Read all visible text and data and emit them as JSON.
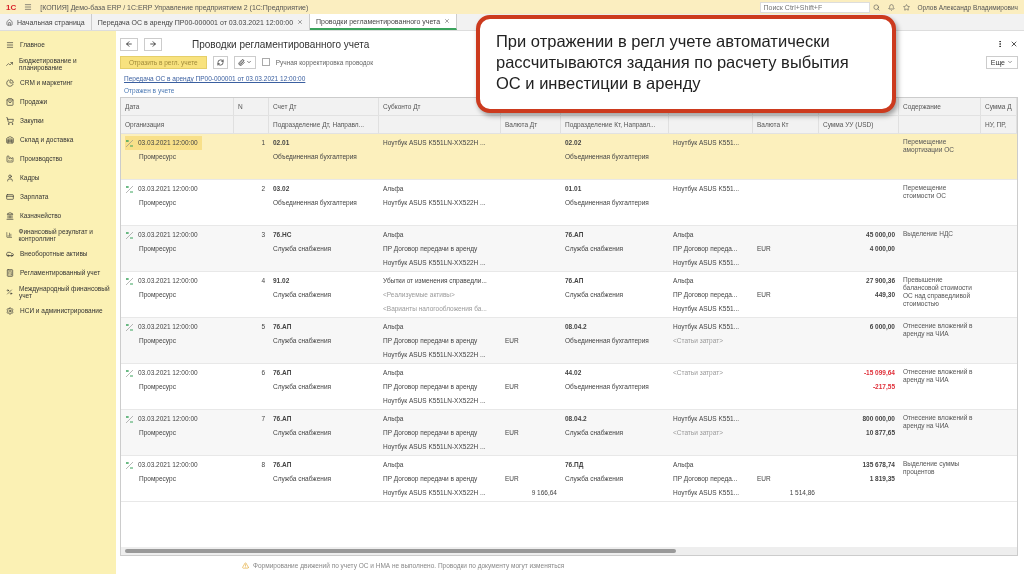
{
  "titlebar": {
    "logo": "1С",
    "title": "[КОПИЯ] Демо-база ERP / 1С:ERP Управление предприятием 2 (1С:Предприятие)",
    "search_placeholder": "Поиск Ctrl+Shift+F",
    "user": "Орлов Александр Владимирович"
  },
  "tabs": [
    {
      "label": "Начальная страница",
      "kind": "home",
      "selected": false
    },
    {
      "label": "Передача ОС в аренду ПР00-000001 от 03.03.2021 12:00:00",
      "kind": "doc",
      "selected": false
    },
    {
      "label": "Проводки регламентированного учета",
      "kind": "doc",
      "selected": true
    }
  ],
  "sidebar": {
    "items": [
      {
        "label": "Главное"
      },
      {
        "label": "Бюджетирование и планирование"
      },
      {
        "label": "CRM и маркетинг"
      },
      {
        "label": "Продажи"
      },
      {
        "label": "Закупки"
      },
      {
        "label": "Склад и доставка"
      },
      {
        "label": "Производство"
      },
      {
        "label": "Кадры"
      },
      {
        "label": "Зарплата"
      },
      {
        "label": "Казначейство"
      },
      {
        "label": "Финансовый результат и контроллинг"
      },
      {
        "label": "Внеоборотные активы"
      },
      {
        "label": "Регламентированный учет"
      },
      {
        "label": "Международный финансовый учет"
      },
      {
        "label": "НСИ и администрирование"
      }
    ]
  },
  "form": {
    "title": "Проводки регламентированного учета",
    "post_button": "Отразить в регл. учете",
    "manual_checkbox": {
      "label": "Ручная корректировка проводок",
      "checked": false
    },
    "more_button": "Еще",
    "document_link": "Передача ОС в аренду ПР00-000001 от 03.03.2021 12:00:00",
    "status_label": "Отражен в учете"
  },
  "table": {
    "columns": [
      {
        "top": "Дата",
        "bottom": "Организация"
      },
      {
        "top": "N"
      },
      {
        "top": "Счет Дт",
        "bottom": "Подразделение Дт, Направл..."
      },
      {
        "top": "Субконто Дт"
      },
      {
        "bottom": "Валюта Дт"
      },
      {
        "bottom": "Подразделение Кт, Направл..."
      },
      {},
      {
        "bottom": "Валюта Кт"
      },
      {
        "bottom": "Сумма УУ (USD)"
      },
      {
        "top": "Содержание"
      },
      {
        "top": "Сумма Д",
        "bottom": "НУ, ПР,"
      }
    ],
    "rows": [
      {
        "selected": true,
        "date": "03.03.2021 12:00:00",
        "org": "Промресурс",
        "n": "1",
        "dt": "02.01",
        "dt_div": "Объединенная бухгалтерия",
        "sub_dt": [
          {
            "text": "Ноутбук ASUS K551LN-XX522H ...",
            "empty": false
          }
        ],
        "cur_dt": "",
        "amt_dt": "",
        "kt": "02.02",
        "kt_div": "Объединенная бухгалтерия",
        "sub_kt": [
          {
            "text": "Ноутбук ASUS K551...",
            "empty": false
          }
        ],
        "cur_kt": "",
        "amt_kt": "",
        "sum": "",
        "sum2": "",
        "content": "Перемещение амортизации ОС"
      },
      {
        "selected": false,
        "date": "03.03.2021 12:00:00",
        "org": "Промресурс",
        "n": "2",
        "dt": "03.02",
        "dt_div": "Объединенная бухгалтерия",
        "sub_dt": [
          {
            "text": "Альфа",
            "empty": false
          },
          {
            "text": "Ноутбук ASUS K551LN-XX522H ...",
            "empty": false
          }
        ],
        "cur_dt": "",
        "amt_dt": "",
        "kt": "01.01",
        "kt_div": "Объединенная бухгалтерия",
        "sub_kt": [
          {
            "text": "Ноутбук ASUS K551...",
            "empty": false
          }
        ],
        "cur_kt": "",
        "amt_kt": "",
        "sum": "",
        "sum2": "",
        "content": "Перемещение стоимости ОС"
      },
      {
        "selected": false,
        "date": "03.03.2021 12:00:00",
        "org": "Промресурс",
        "n": "3",
        "dt": "76.НС",
        "dt_div": "Служба снабжения",
        "sub_dt": [
          {
            "text": "Альфа",
            "empty": false
          },
          {
            "text": "ПР Договор передачи в аренду",
            "empty": false
          },
          {
            "text": "Ноутбук ASUS K551LN-XX522H ...",
            "empty": false
          }
        ],
        "cur_dt": "",
        "amt_dt": "",
        "kt": "76.АП",
        "kt_div": "Служба снабжения",
        "sub_kt": [
          {
            "text": "Альфа",
            "empty": false
          },
          {
            "text": "ПР Договор переда...",
            "empty": false
          },
          {
            "text": "Ноутбук ASUS K551...",
            "empty": false
          }
        ],
        "cur_kt": "EUR",
        "amt_kt": "",
        "sum": "45 000,00",
        "sum2": "4 000,00",
        "negative": false,
        "content": "Выделение НДС"
      },
      {
        "selected": false,
        "date": "03.03.2021 12:00:00",
        "org": "Промресурс",
        "n": "4",
        "dt": "91.02",
        "dt_div": "Служба снабжения",
        "sub_dt": [
          {
            "text": "Убытки от изменения справедли...",
            "empty": false
          },
          {
            "text": "<Реализуемые активы>",
            "empty": true
          },
          {
            "text": "<Варианты налогообложения ба...",
            "empty": true
          }
        ],
        "cur_dt": "",
        "amt_dt": "",
        "kt": "76.АП",
        "kt_div": "Служба снабжения",
        "sub_kt": [
          {
            "text": "Альфа",
            "empty": false
          },
          {
            "text": "ПР Договор переда...",
            "empty": false
          },
          {
            "text": "Ноутбук ASUS K551...",
            "empty": false
          }
        ],
        "cur_kt": "EUR",
        "amt_kt": "",
        "sum": "27 900,36",
        "sum2": "449,30",
        "negative": false,
        "content": "Превышение балансовой стоимости ОС над справедливой стоимостью"
      },
      {
        "selected": false,
        "date": "03.03.2021 12:00:00",
        "org": "Промресурс",
        "n": "5",
        "dt": "76.АП",
        "dt_div": "Служба снабжения",
        "sub_dt": [
          {
            "text": "Альфа",
            "empty": false
          },
          {
            "text": "ПР Договор передачи в аренду",
            "empty": false
          },
          {
            "text": "Ноутбук ASUS K551LN-XX522H ...",
            "empty": false
          }
        ],
        "cur_dt": "EUR",
        "amt_dt": "",
        "kt": "08.04.2",
        "kt_div": "Объединенная бухгалтерия",
        "sub_kt": [
          {
            "text": "Ноутбук ASUS K551...",
            "empty": false
          },
          {
            "text": "<Статьи затрат>",
            "empty": true
          }
        ],
        "cur_kt": "",
        "amt_kt": "",
        "sum": "6 000,00",
        "sum2": "",
        "negative": false,
        "content": "Отнесение вложений в аренду на ЧИА"
      },
      {
        "selected": false,
        "date": "03.03.2021 12:00:00",
        "org": "Промресурс",
        "n": "6",
        "dt": "76.АП",
        "dt_div": "Служба снабжения",
        "sub_dt": [
          {
            "text": "Альфа",
            "empty": false
          },
          {
            "text": "ПР Договор передачи в аренду",
            "empty": false
          },
          {
            "text": "Ноутбук ASUS K551LN-XX522H ...",
            "empty": false
          }
        ],
        "cur_dt": "EUR",
        "amt_dt": "",
        "kt": "44.02",
        "kt_div": "Объединенная бухгалтерия",
        "sub_kt": [
          {
            "text": "<Статьи затрат>",
            "empty": true
          }
        ],
        "cur_kt": "",
        "amt_kt": "",
        "sum": "-15 099,64",
        "sum2": "-217,55",
        "negative": true,
        "content": "Отнесение вложений в аренду на ЧИА"
      },
      {
        "selected": false,
        "date": "03.03.2021 12:00:00",
        "org": "Промресурс",
        "n": "7",
        "dt": "76.АП",
        "dt_div": "Служба снабжения",
        "sub_dt": [
          {
            "text": "Альфа",
            "empty": false
          },
          {
            "text": "ПР Договор передачи в аренду",
            "empty": false
          },
          {
            "text": "Ноутбук ASUS K551LN-XX522H ...",
            "empty": false
          }
        ],
        "cur_dt": "EUR",
        "amt_dt": "",
        "kt": "08.04.2",
        "kt_div": "Служба снабжения",
        "sub_kt": [
          {
            "text": "Ноутбук ASUS K551...",
            "empty": false
          },
          {
            "text": "<Статьи затрат>",
            "empty": true
          }
        ],
        "cur_kt": "",
        "amt_kt": "",
        "sum": "800 000,00",
        "sum2": "10 877,65",
        "negative": false,
        "content": "Отнесение вложений в аренду на ЧИА"
      },
      {
        "selected": false,
        "date": "03.03.2021 12:00:00",
        "org": "Промресурс",
        "n": "8",
        "dt": "76.АП",
        "dt_div": "Служба снабжения",
        "sub_dt": [
          {
            "text": "Альфа",
            "empty": false
          },
          {
            "text": "ПР Договор передачи в аренду",
            "empty": false
          },
          {
            "text": "Ноутбук ASUS K551LN-XX522H ...",
            "empty": false
          }
        ],
        "cur_dt": "EUR",
        "amt_dt": "9 166,64",
        "kt": "76.ПД",
        "kt_div": "Служба снабжения",
        "sub_kt": [
          {
            "text": "Альфа",
            "empty": false
          },
          {
            "text": "ПР Договор переда...",
            "empty": false
          },
          {
            "text": "Ноутбук ASUS K551...",
            "empty": false
          }
        ],
        "cur_kt": "EUR",
        "amt_kt": "1 514,86",
        "sum": "135 678,74",
        "sum2": "1 819,35",
        "negative": false,
        "content": "Выделение суммы процентов"
      }
    ]
  },
  "status_bar": "Формирование движений по учету ОС и НМА не выполнено. Проводки по документу могут изменяться",
  "callout": "При отражении в регл учете автоматически рассчитываются задания по расчету выбытия ОС и инвестиции в аренду"
}
